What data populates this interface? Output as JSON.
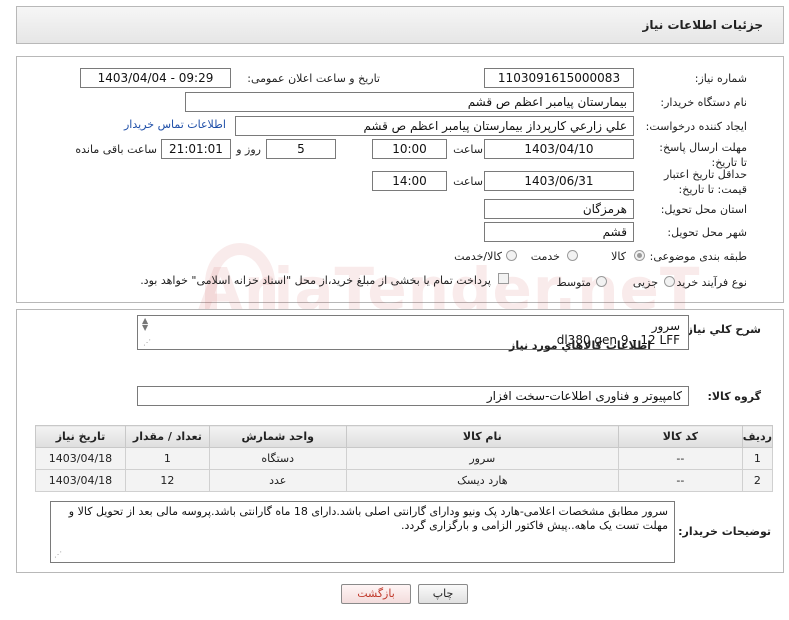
{
  "header": {
    "title": "جزئیات اطلاعات نیاز"
  },
  "form": {
    "need_number_label": "شماره نیاز:",
    "need_number": "1103091615000083",
    "announce_label": "تاریخ و ساعت اعلان عمومی:",
    "announce_value": "1403/04/04 - 09:29",
    "buyer_org_label": "نام دستگاه خریدار:",
    "buyer_org": "بیمارستان پیامبر اعظم  ص  قشم",
    "creator_label": "ایجاد کننده درخواست:",
    "creator": "علي زارعي کارپرداز بیمارستان پیامبر اعظم  ص  قشم",
    "contact_link": "اطلاعات تماس خریدار",
    "reply_deadline_label": "مهلت ارسال پاسخ: تا تاریخ:",
    "reply_date": "1403/04/10",
    "time_label": "ساعت",
    "reply_time": "10:00",
    "days_value": "5",
    "days_label": "روز و",
    "remaining_time": "21:01:01",
    "remaining_label": "ساعت باقی مانده",
    "price_deadline_label": "حداقل تاریخ اعتبار قیمت: تا تاریخ:",
    "price_date": "1403/06/31",
    "price_time": "14:00",
    "province_label": "استان محل تحویل:",
    "province": "هرمزگان",
    "city_label": "شهر محل تحویل:",
    "city": "قشم",
    "category_label": "طبقه بندی موضوعی:",
    "category_options": [
      "کالا",
      "خدمت",
      "کالا/خدمت"
    ],
    "process_label": "نوع فرآیند خرید :",
    "process_options": [
      "جزیی",
      "متوسط"
    ],
    "payment_note": "پرداخت تمام یا بخشی از مبلغ خرید،از محل \"اسناد خزانه اسلامی\" خواهد بود."
  },
  "summary": {
    "label": "شرح کلي نياز:",
    "line1": "سرور",
    "line2": "dl380 gen 9 - 12 LFF",
    "goods_info_title": "اطلاعات کالاهاي مورد نياز",
    "group_label": "گروه کالا:",
    "group_value": "کامپیوتر و فناوری اطلاعات-سخت افزار"
  },
  "table": {
    "headers": [
      "ردیف",
      "کد کالا",
      "نام کالا",
      "واحد شمارش",
      "تعداد / مقدار",
      "تاریخ نیاز"
    ],
    "rows": [
      [
        "1",
        "--",
        "سرور",
        "دستگاه",
        "1",
        "1403/04/18"
      ],
      [
        "2",
        "--",
        "هارد دیسک",
        "عدد",
        "12",
        "1403/04/18"
      ]
    ]
  },
  "notes": {
    "label": "توضیحات خریدار:",
    "text": "سرور مطابق مشخصات اعلامی-هارد پک ونیو ودارای گارانتی اصلی باشد.دارای 18 ماه گارانتی باشد.پروسه مالی بعد از تحویل کالا و مهلت تست یک ماهه..پیش فاکتور الزامی و بارگزاری گردد."
  },
  "buttons": {
    "print": "چاپ",
    "back": "بازگشت"
  },
  "watermark": "AriaTender.neT",
  "colors": {
    "link": "#1f4fa8",
    "back_button_text": "#c0392b"
  }
}
